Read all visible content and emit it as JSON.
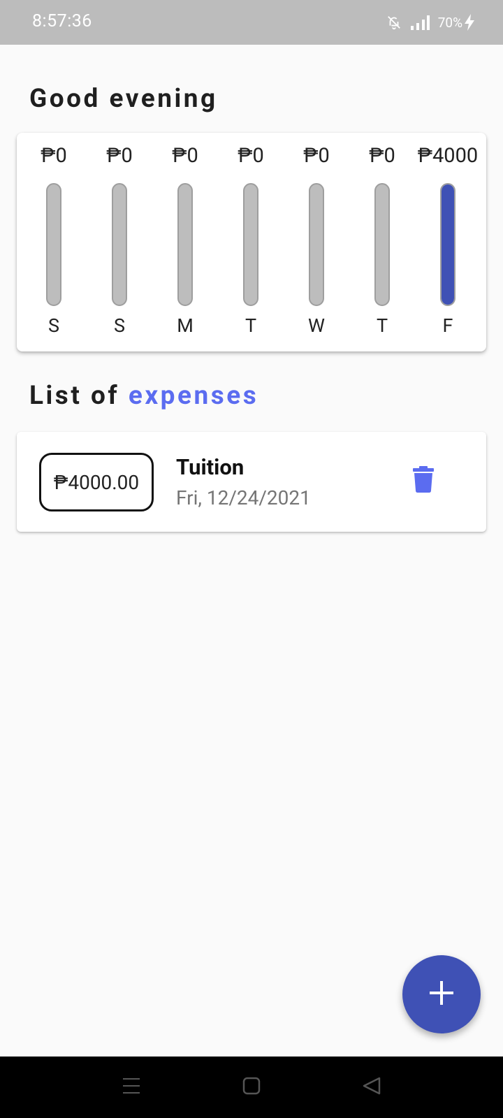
{
  "status_bar": {
    "time": "8:57:36",
    "battery": "70%",
    "icons": [
      "bell-off-icon",
      "signal-icon",
      "charging-icon"
    ]
  },
  "greeting": "Good evening",
  "chart_data": {
    "type": "bar",
    "categories": [
      "S",
      "S",
      "M",
      "T",
      "W",
      "T",
      "F"
    ],
    "labels": [
      "₱0",
      "₱0",
      "₱0",
      "₱0",
      "₱0",
      "₱0",
      "₱4000"
    ],
    "values": [
      0,
      0,
      0,
      0,
      0,
      0,
      4000
    ],
    "ylim": [
      0,
      4000
    ],
    "colors": {
      "fill": "#3f51b5",
      "track": "#bdbdbd"
    }
  },
  "list_heading": {
    "prefix": "List of",
    "accent": "expenses"
  },
  "expenses": [
    {
      "amount": "₱4000.00",
      "title": "Tuition",
      "date": "Fri, 12/24/2021"
    }
  ],
  "colors": {
    "primary": "#3f51b5",
    "accent": "#5b6cf0"
  },
  "icons": {
    "delete": "trash-icon",
    "fab": "plus-icon",
    "nav": [
      "menu-icon",
      "home-square-icon",
      "back-triangle-icon"
    ]
  }
}
